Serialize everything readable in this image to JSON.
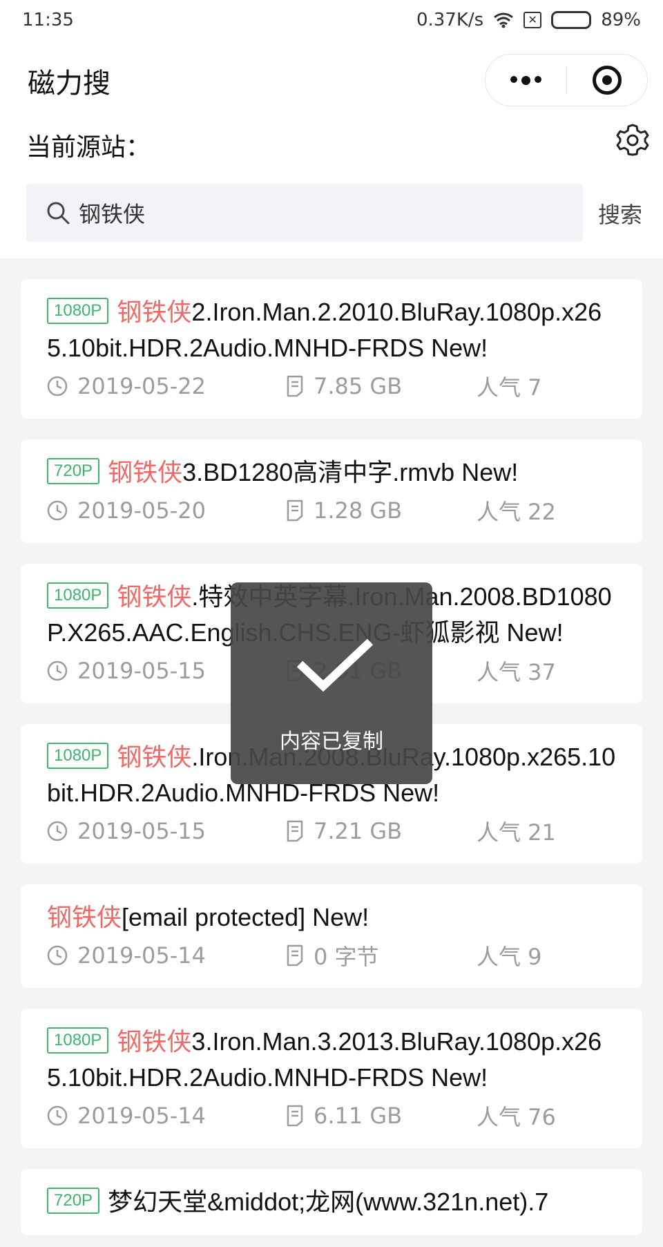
{
  "status_bar": {
    "time": "11:35",
    "network_speed": "0.37K/s",
    "battery": "89%",
    "battery_level": 0.89
  },
  "nav": {
    "title": "磁力搜"
  },
  "source": {
    "label": "当前源站："
  },
  "search": {
    "query": "钢铁侠",
    "button_label": "搜索"
  },
  "results": [
    {
      "tag": "1080P",
      "highlight": "钢铁侠",
      "rest": "2.Iron.Man.2.2010.BluRay.1080p.x265.10bit.HDR.2Audio.MNHD-FRDS New!",
      "date": "2019-05-22",
      "size": "7.85 GB",
      "popularity": "人气 7"
    },
    {
      "tag": "720P",
      "highlight": "钢铁侠",
      "rest": "3.BD1280高清中字.rmvb New!",
      "date": "2019-05-20",
      "size": "1.28 GB",
      "popularity": "人气 22"
    },
    {
      "tag": "1080P",
      "highlight": "钢铁侠",
      "rest": ".特效中英字幕.Iron.Man.2008.BD1080P.X265.AAC.English.CHS.ENG-虾狐影视 New!",
      "date": "2019-05-15",
      "size": "2.91 GB",
      "popularity": "人气 37"
    },
    {
      "tag": "1080P",
      "highlight": "钢铁侠",
      "rest": ".Iron.Man.2008.BluRay.1080p.x265.10bit.HDR.2Audio.MNHD-FRDS New!",
      "date": "2019-05-15",
      "size": "7.21 GB",
      "popularity": "人气 21"
    },
    {
      "tag": "",
      "highlight": "钢铁侠",
      "rest": "[email protected] New!",
      "date": "2019-05-14",
      "size": "0 字节",
      "popularity": "人气 9"
    },
    {
      "tag": "1080P",
      "highlight": "钢铁侠",
      "rest": "3.Iron.Man.3.2013.BluRay.1080p.x265.10bit.HDR.2Audio.MNHD-FRDS New!",
      "date": "2019-05-14",
      "size": "6.11 GB",
      "popularity": "人气 76"
    },
    {
      "tag": "720P",
      "highlight": "",
      "rest": "梦幻天堂&middot;龙网(www.321n.net).7",
      "date": "",
      "size": "",
      "popularity": ""
    }
  ],
  "toast": {
    "message": "内容已复制"
  },
  "colors": {
    "highlight": "#ef6a66",
    "tag_green": "#3fb56c",
    "meta_gray": "#9c9c9c"
  }
}
